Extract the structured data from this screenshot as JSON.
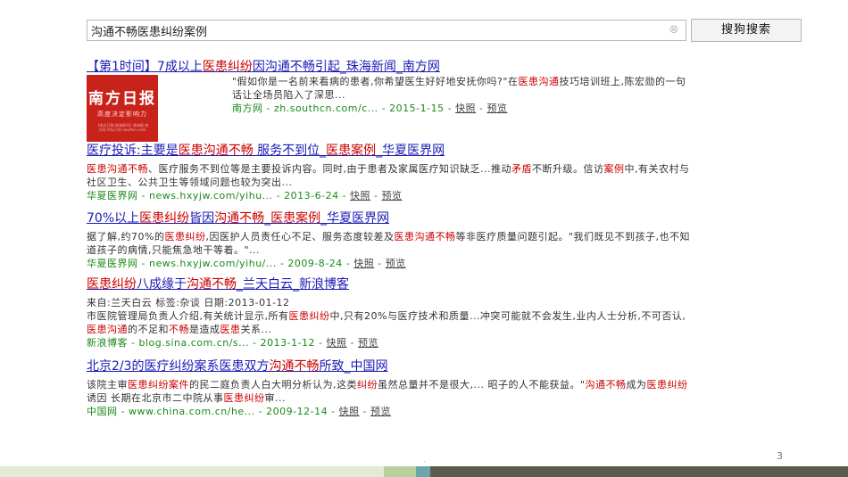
{
  "search": {
    "query": "沟通不畅医患纠纷案例",
    "button_label": "搜狗搜索",
    "clear_glyph": "⊗"
  },
  "results": [
    {
      "title": [
        "【第1时间】7成以上",
        {
          "hl": "医患纠纷"
        },
        "因沟通不畅引起_珠海新闻_南方网"
      ],
      "thumb": {
        "logo": "南方日报",
        "slogan": "高度决定影响力",
        "fine": "【南方日报·南海周刊】南海版 南方网 http://zh.southcn.com"
      },
      "snippet": [
        "\"假如你是一名前来看病的患者,你希望医生好好地安抚你吗?\"在",
        {
          "hl": "医患沟通"
        },
        "技巧培训班上,陈宏勋的一句话让全场员陷入了深思..."
      ],
      "source": "南方网",
      "url": "zh.southcn.com/c...",
      "date": "2015-1-15",
      "snapshot": "快照",
      "preview": "预览"
    },
    {
      "title": [
        "医疗投诉:主要是",
        {
          "hl": "医患沟通不畅"
        },
        " 服务不到位_",
        {
          "hl": "医患案例"
        },
        "_华夏医界网"
      ],
      "snippet": [
        {
          "hl": "医患沟通不畅"
        },
        "、医疗服务不到位等是主要投诉内容。同时,由于患者及家属医疗知识缺乏...推动",
        {
          "hl": "矛盾"
        },
        "不断升级。信访",
        {
          "hl": "案例"
        },
        "中,有关农村与社区卫生、公共卫生等领域问题也较为突出..."
      ],
      "source": "华夏医界网",
      "url": "news.hxyjw.com/yihu...",
      "date": "2013-6-24",
      "snapshot": "快照",
      "preview": "预览"
    },
    {
      "title": [
        "70%以上",
        {
          "hl": "医患纠纷"
        },
        "皆因",
        {
          "hl": "沟通不畅"
        },
        "_",
        {
          "hl": "医患案例"
        },
        "_华夏医界网"
      ],
      "snippet": [
        "据了解,约70%的",
        {
          "hl": "医患纠纷"
        },
        ",因医护人员责任心不足、服务态度较差及",
        {
          "hl": "医患沟通不畅"
        },
        "等非医疗质量问题引起。\"我们既见不到孩子,也不知道孩子的病情,只能焦急地干等着。\"..."
      ],
      "source": "华夏医界网",
      "url": "news.hxyjw.com/yihu/...",
      "date": "2009-8-24",
      "snapshot": "快照",
      "preview": "预览"
    },
    {
      "title": [
        {
          "hl": "医患纠纷"
        },
        "八成缘于",
        {
          "hl": "沟通不畅"
        },
        "_兰天白云_新浪博客"
      ],
      "snippet": [
        "来自:兰天白云 标签:杂谈 日期:2013-01-12",
        {
          "br": true
        },
        "市医院管理局负责人介绍,有关统计显示,所有",
        {
          "hl": "医患纠纷"
        },
        "中,只有20%与医疗技术和质量...冲突可能就不会发生,业内人士分析,不可否认,",
        {
          "hl": "医患沟通"
        },
        "的不足和",
        {
          "hl": "不畅"
        },
        "是造成",
        {
          "hl": "医患"
        },
        "关系..."
      ],
      "source": "新浪博客",
      "url": "blog.sina.com.cn/s...",
      "date": "2013-1-12",
      "snapshot": "快照",
      "preview": "预览"
    },
    {
      "title": [
        "北京2/3的医疗纠纷案系医患双方",
        {
          "hl": "沟通不畅"
        },
        "所致_中国网"
      ],
      "snippet": [
        "该院主审",
        {
          "hl": "医患纠纷案件"
        },
        "的民二庭负责人白大明分析认为,这类",
        {
          "hl": "纠纷"
        },
        "虽然总量并不是很大,... 昭子的人不能获益。\"",
        {
          "hl": "沟通不畅"
        },
        "成为",
        {
          "hl": "医患纠纷"
        },
        "诱因 长期在北京市二中院从事",
        {
          "hl": "医患纠纷"
        },
        "审..."
      ],
      "source": "中国网",
      "url": "www.china.com.cn/he...",
      "date": "2009-12-14",
      "snapshot": "快照",
      "preview": "预览"
    }
  ],
  "page_number": "3",
  "dot": "."
}
